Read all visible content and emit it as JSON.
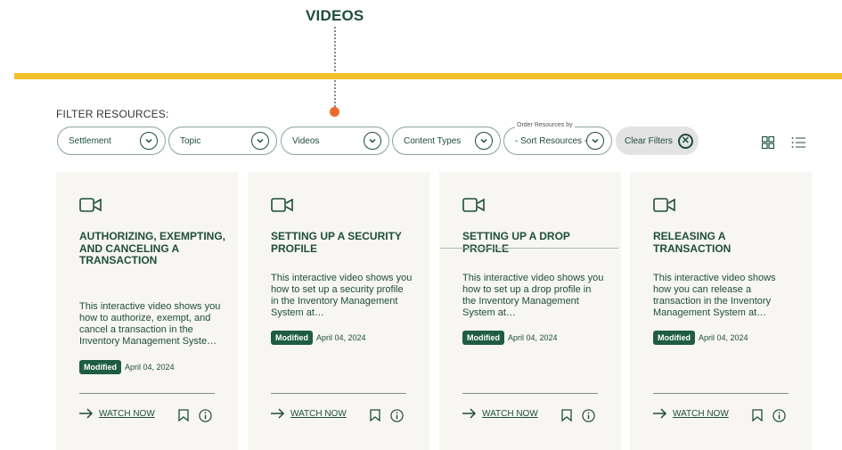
{
  "annotation": {
    "label": "VIDEOS"
  },
  "filter": {
    "label": "FILTER RESOURCES:",
    "dropdowns": [
      {
        "value": "Settlement"
      },
      {
        "value": "Topic"
      },
      {
        "value": "Videos"
      },
      {
        "value": "Content Types"
      },
      {
        "legend": "Order Resources by",
        "value": "- Sort Resources -"
      }
    ],
    "clear_label": "Clear Filters"
  },
  "colors": {
    "accent_bar": "#f2c12e",
    "brand_green": "#1f4d3b",
    "badge_green": "#1f5c45",
    "annotation_dot": "#ee6b2b",
    "card_bg": "#f7f6f2"
  },
  "cards": [
    {
      "icon": "video-camera-icon",
      "title": "AUTHORIZING, EXEMPTING, AND CANCELING A TRANSACTION",
      "description": "This interactive video shows you how to authorize, exempt, and cancel a transaction in the Inventory Management System at…",
      "badge": "Modified",
      "date": "April 04, 2024",
      "cta": "WATCH NOW"
    },
    {
      "icon": "video-camera-icon",
      "title": "SETTING UP A SECURITY PROFILE",
      "description": "This interactive video shows you how to set up a security profile in the Inventory Management System at…",
      "badge": "Modified",
      "date": "April 04, 2024",
      "cta": "WATCH NOW"
    },
    {
      "icon": "video-camera-icon",
      "title": "SETTING UP A DROP PROFILE",
      "description": "This interactive video shows you how to set up a drop profile in the Inventory Management System at…",
      "badge": "Modified",
      "date": "April 04, 2024",
      "cta": "WATCH NOW"
    },
    {
      "icon": "video-camera-icon",
      "title": "RELEASING A TRANSACTION",
      "description": "This interactive video shows how you can release a transaction in the Inventory Management System at…",
      "badge": "Modified",
      "date": "April 04, 2024",
      "cta": "WATCH NOW"
    }
  ]
}
